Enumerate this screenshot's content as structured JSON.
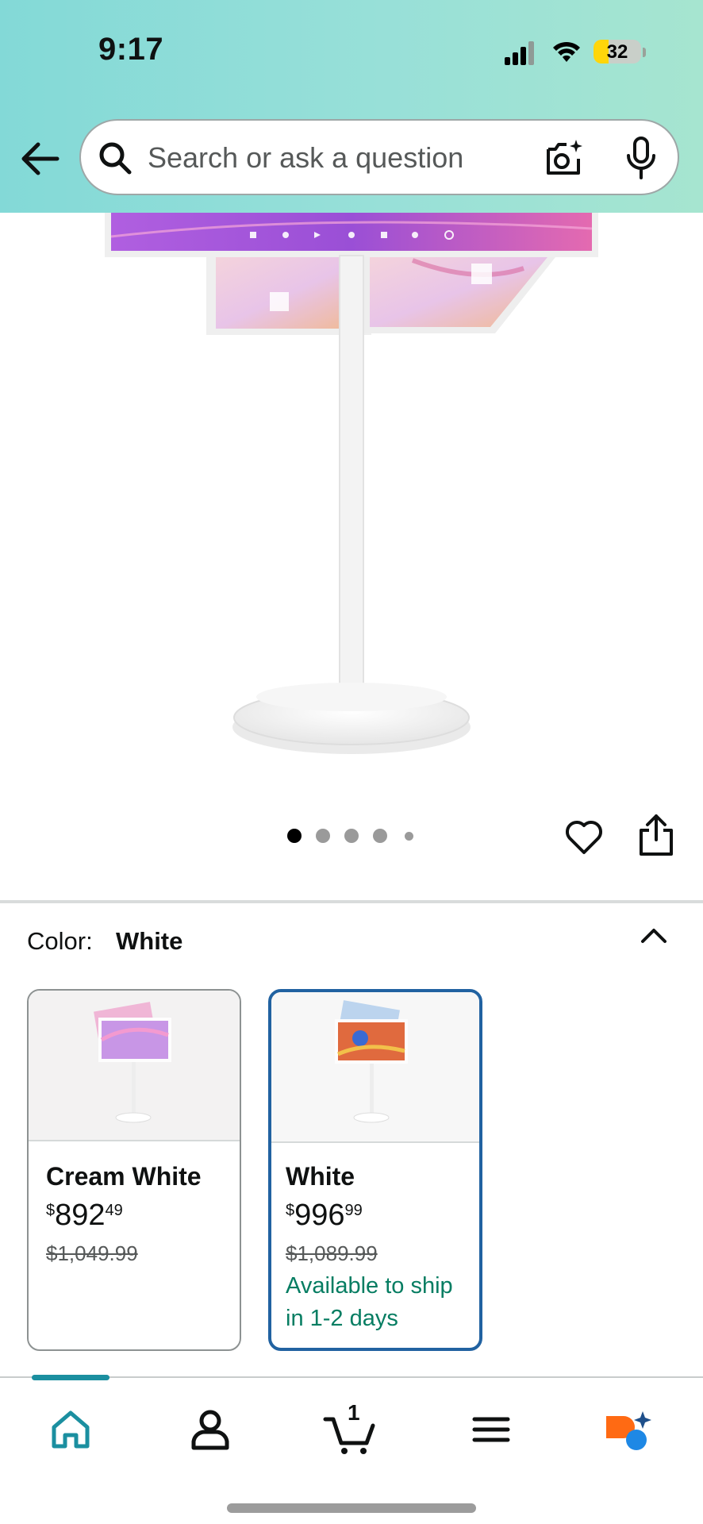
{
  "status_bar": {
    "time": "9:17",
    "battery": "32"
  },
  "header": {
    "back_icon": "arrow-left-icon",
    "search_placeholder": "Search or ask a question",
    "camera_icon": "camera-lens-icon",
    "mic_icon": "microphone-icon"
  },
  "gallery": {
    "image_count": 5,
    "active_index": 0,
    "wishlist_icon": "heart-icon",
    "share_icon": "share-icon"
  },
  "color_selector": {
    "label": "Color:",
    "selected": "White",
    "options": [
      {
        "name": "Cream White",
        "price_symbol": "$",
        "price_whole": "892",
        "price_fraction": "49",
        "list_price": "$1,049.99",
        "availability": "",
        "selected": false
      },
      {
        "name": "White",
        "price_symbol": "$",
        "price_whole": "996",
        "price_fraction": "99",
        "list_price": "$1,089.99",
        "availability": "Available to ship in 1-2 days",
        "selected": true
      }
    ]
  },
  "bottom_nav": {
    "items": [
      {
        "name": "home",
        "icon": "home-icon",
        "active": true
      },
      {
        "name": "account",
        "icon": "person-icon",
        "active": false
      },
      {
        "name": "cart",
        "icon": "cart-icon",
        "count": "1",
        "active": false
      },
      {
        "name": "menu",
        "icon": "hamburger-menu-icon",
        "active": false
      },
      {
        "name": "rufus",
        "icon": "rufus-assistant-icon",
        "active": false
      }
    ]
  },
  "colors": {
    "header_gradient_start": "#83d9d7",
    "header_gradient_end": "#a6e5d0",
    "selected_border": "#2162a1",
    "availability_green": "#067d62",
    "nav_active": "#1b8fa0"
  }
}
